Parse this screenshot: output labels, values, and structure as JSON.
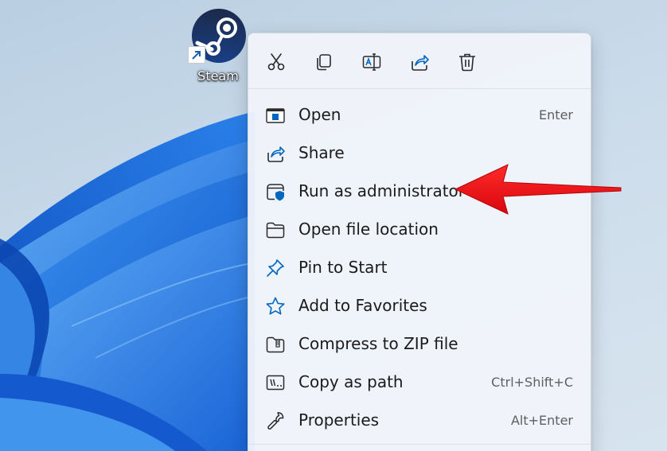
{
  "desktop_icon": {
    "label": "Steam",
    "icon": "steam-logo-icon",
    "shortcut_overlay": "shortcut-arrow-icon"
  },
  "context_menu": {
    "toolbar": [
      {
        "id": "cut",
        "icon": "scissors-icon"
      },
      {
        "id": "copy",
        "icon": "copy-icon"
      },
      {
        "id": "rename",
        "icon": "rename-icon"
      },
      {
        "id": "share",
        "icon": "share-icon"
      },
      {
        "id": "delete",
        "icon": "trash-icon"
      }
    ],
    "items": [
      {
        "label": "Open",
        "shortcut": "Enter",
        "icon": "open-window-icon"
      },
      {
        "label": "Share",
        "shortcut": "",
        "icon": "share-icon"
      },
      {
        "label": "Run as administrator",
        "shortcut": "",
        "icon": "shield-window-icon"
      },
      {
        "label": "Open file location",
        "shortcut": "",
        "icon": "folder-icon"
      },
      {
        "label": "Pin to Start",
        "shortcut": "",
        "icon": "pin-icon"
      },
      {
        "label": "Add to Favorites",
        "shortcut": "",
        "icon": "star-icon"
      },
      {
        "label": "Compress to ZIP file",
        "shortcut": "",
        "icon": "zip-folder-icon"
      },
      {
        "label": "Copy as path",
        "shortcut": "Ctrl+Shift+C",
        "icon": "path-icon"
      },
      {
        "label": "Properties",
        "shortcut": "Alt+Enter",
        "icon": "wrench-icon"
      }
    ]
  },
  "annotation": {
    "target": "Run as administrator",
    "color": "#e8141a"
  },
  "colors": {
    "menu_background": "#f0f4fa",
    "wallpaper_blue": "#1e6fe0",
    "text": "#1b1b1b",
    "shortcut_text": "#5f5f5f",
    "accent": "#0067c0"
  }
}
